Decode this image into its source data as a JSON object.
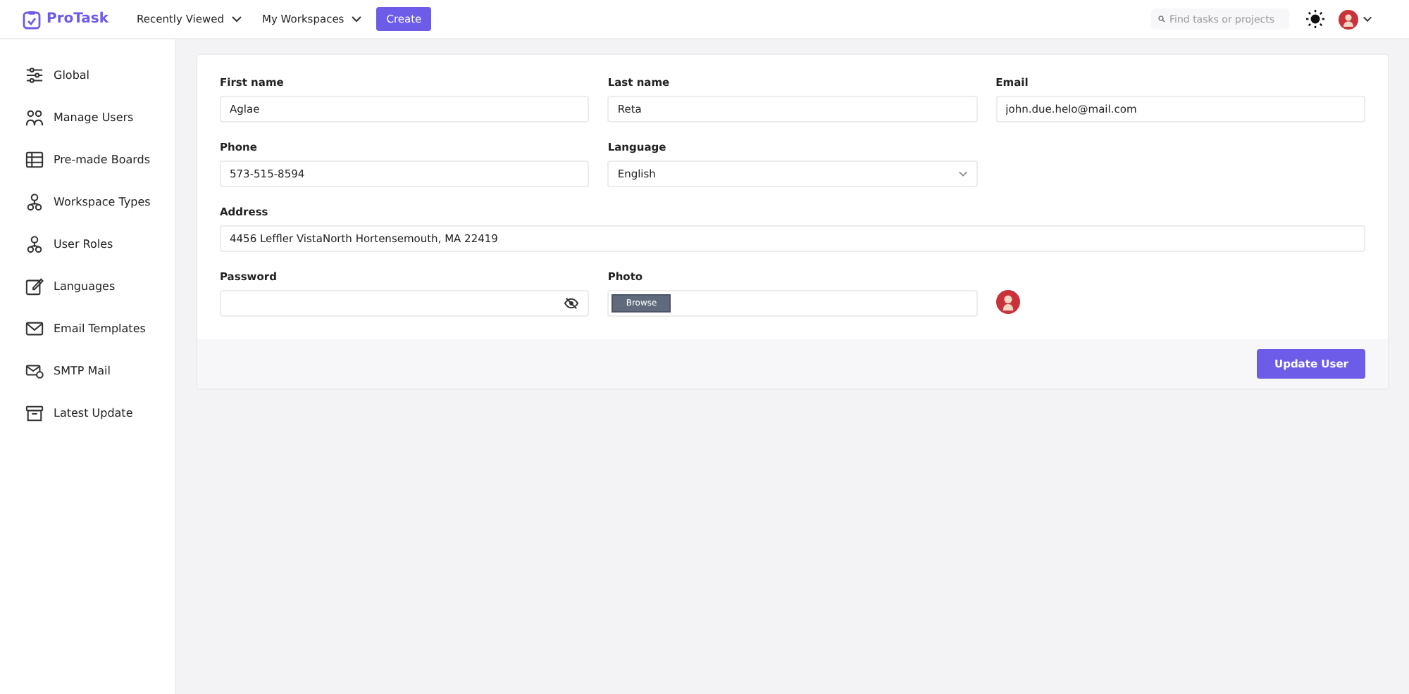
{
  "header": {
    "logo": "ProTask",
    "menus": [
      "Recently Viewed",
      "My Workspaces"
    ],
    "create_button": "Create",
    "search": {
      "placeholder": "Find tasks or projects"
    }
  },
  "sidebar": {
    "items": [
      "Global",
      "Manage Users",
      "Pre-made Boards",
      "Workspace Types",
      "User Roles",
      "Languages",
      "Email Templates",
      "SMTP Mail",
      "Latest Update"
    ]
  },
  "form": {
    "fields": [
      {
        "kind": "text",
        "label": "First name",
        "value": "Aglae"
      },
      {
        "kind": "text",
        "label": "Last name",
        "value": "Reta"
      },
      {
        "kind": "text",
        "label": "Email",
        "value": "john.due.helo@mail.com"
      },
      {
        "kind": "text",
        "label": "Phone",
        "value": "573-515-8594"
      },
      {
        "kind": "select",
        "label": "Language",
        "value": "English"
      },
      {
        "kind": "blank"
      },
      {
        "kind": "wide",
        "label": "Address",
        "value": "4456 Leffler VistaNorth Hortensemouth, MA 22419"
      },
      {
        "kind": "password",
        "label": "Password"
      },
      {
        "kind": "file",
        "label": "Photo",
        "button": "Browse"
      },
      {
        "kind": "preview"
      }
    ],
    "submit": "Update User"
  }
}
